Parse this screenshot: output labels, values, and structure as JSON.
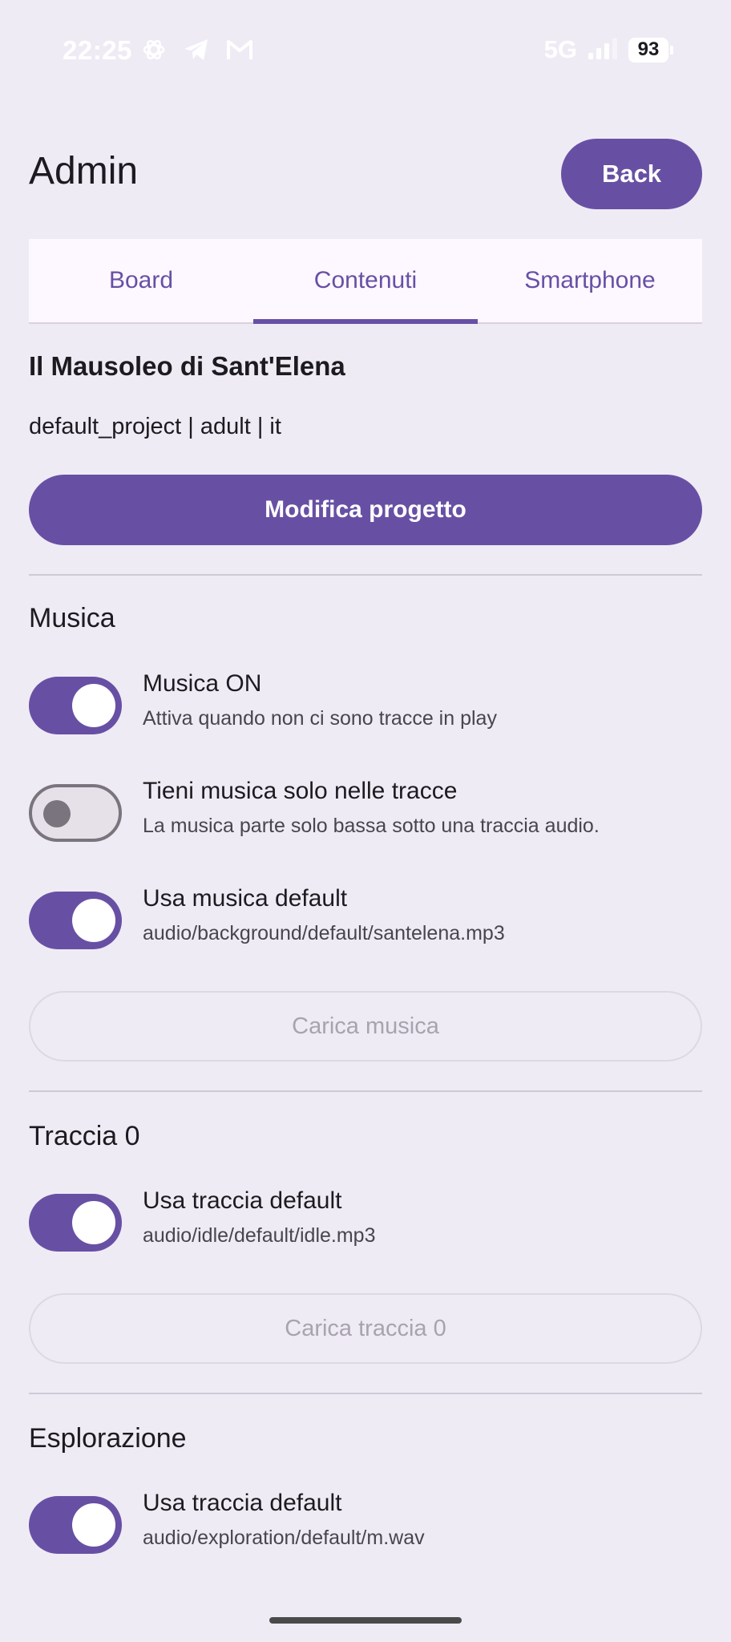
{
  "status_bar": {
    "time": "22:25",
    "network": "5G",
    "battery": "93",
    "icons": [
      "openai-icon",
      "telegram-icon",
      "gmail-icon",
      "signal-icon"
    ]
  },
  "header": {
    "title": "Admin",
    "back_label": "Back"
  },
  "tabs": [
    {
      "label": "Board",
      "active": false
    },
    {
      "label": "Contenuti",
      "active": true
    },
    {
      "label": "Smartphone",
      "active": false
    }
  ],
  "project": {
    "title": "Il Mausoleo di Sant'Elena",
    "meta": "default_project | adult | it",
    "edit_label": "Modifica progetto"
  },
  "music": {
    "title": "Musica",
    "toggles": [
      {
        "label": "Musica ON",
        "description": "Attiva quando non ci sono tracce in play",
        "on": true
      },
      {
        "label": "Tieni musica solo nelle tracce",
        "description": "La musica parte solo bassa sotto una traccia audio.",
        "on": false
      },
      {
        "label": "Usa musica default",
        "description": "audio/background/default/santelena.mp3",
        "on": true
      }
    ],
    "upload_label": "Carica musica"
  },
  "track0": {
    "title": "Traccia 0",
    "toggle": {
      "label": "Usa traccia default",
      "description": "audio/idle/default/idle.mp3",
      "on": true
    },
    "upload_label": "Carica traccia 0"
  },
  "exploration": {
    "title": "Esplorazione",
    "toggle": {
      "label": "Usa traccia default",
      "description": "audio/exploration/default/m.wav",
      "on": true
    }
  },
  "colors": {
    "primary": "#6750A4",
    "background": "#EFEBF5",
    "tab_background": "#FDF7FF"
  }
}
